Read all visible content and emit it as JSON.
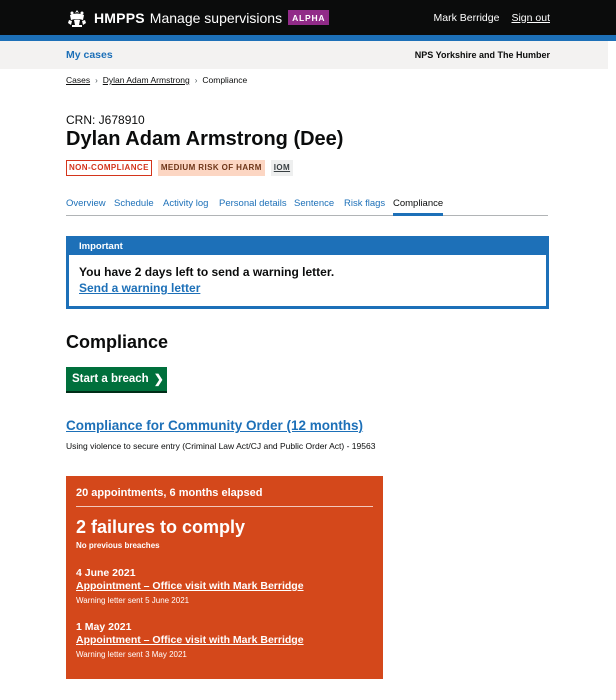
{
  "header": {
    "logo": "HMPPS",
    "service": "Manage supervisions",
    "phase": "ALPHA",
    "user": "Mark Berridge",
    "sign_out": "Sign out"
  },
  "subnav": {
    "my_cases": "My cases",
    "region": "NPS Yorkshire and The Humber"
  },
  "breadcrumb": [
    "Cases",
    "Dylan Adam Armstrong",
    "Compliance"
  ],
  "person": {
    "crn": "CRN: J678910",
    "name": "Dylan Adam Armstrong (Dee)"
  },
  "tags": [
    "NON-COMPLIANCE",
    "MEDIUM RISK OF HARM",
    "IOM"
  ],
  "tabs": [
    "Overview",
    "Schedule",
    "Activity log",
    "Personal details",
    "Sentence",
    "Risk flags",
    "Compliance"
  ],
  "active_tab": "Compliance",
  "banner": {
    "title": "Important",
    "text": "You have 2 days left to send a warning letter.",
    "link": "Send a warning letter"
  },
  "compliance": {
    "heading": "Compliance",
    "breach_button": "Start a breach",
    "order_link": "Compliance for Community Order (12 months)",
    "offence": "Using violence to secure entry (Criminal Law Act/CJ and Public Order Act) - 19563",
    "summary": "20 appointments, 6 months elapsed",
    "failures": "2 failures to comply",
    "previous": "No previous breaches",
    "entries": [
      {
        "date": "4 June 2021",
        "link": "Appointment – Office visit with Mark Berridge",
        "note": "Warning letter sent 5 June 2021"
      },
      {
        "date": "1 May 2021",
        "link": "Appointment – Office visit with Mark Berridge",
        "note": "Warning letter sent 3 May 2021"
      }
    ]
  },
  "colors": {
    "header": "#0b0c0c",
    "brand_blue": "#1d70b8",
    "phase": "#912b88",
    "button_green": "#00703c",
    "panel_red": "#d4481b",
    "tag_red": "#d4351c"
  },
  "icons": [
    "crown-crest-icon",
    "breadcrumb-chevron-icon",
    "chevron-right-icon"
  ]
}
